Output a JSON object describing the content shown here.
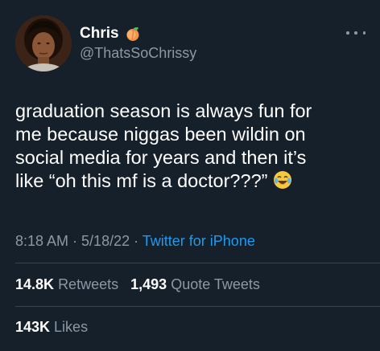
{
  "author": {
    "display_name": "Chris",
    "name_emoji": "peach-icon",
    "handle": "@ThatsSoChrissy"
  },
  "tweet": {
    "lines": [
      "graduation season is always fun for",
      "me because niggas been wildin on",
      "social media for years and then it’s",
      "like “oh this mf is a doctor???”"
    ],
    "trailing_emoji": "laughing-crying-icon"
  },
  "meta": {
    "time": "8:18 AM",
    "separator": " · ",
    "date": "5/18/22",
    "source": "Twitter for iPhone"
  },
  "stats": {
    "retweets_count": "14.8K",
    "retweets_label": "Retweets",
    "quotes_count": "1,493",
    "quotes_label": "Quote Tweets",
    "likes_count": "143K",
    "likes_label": "Likes"
  },
  "colors": {
    "background": "#15202b",
    "secondary_text": "#8b98a5",
    "link": "#1d9bf0",
    "divider": "#38444d"
  }
}
